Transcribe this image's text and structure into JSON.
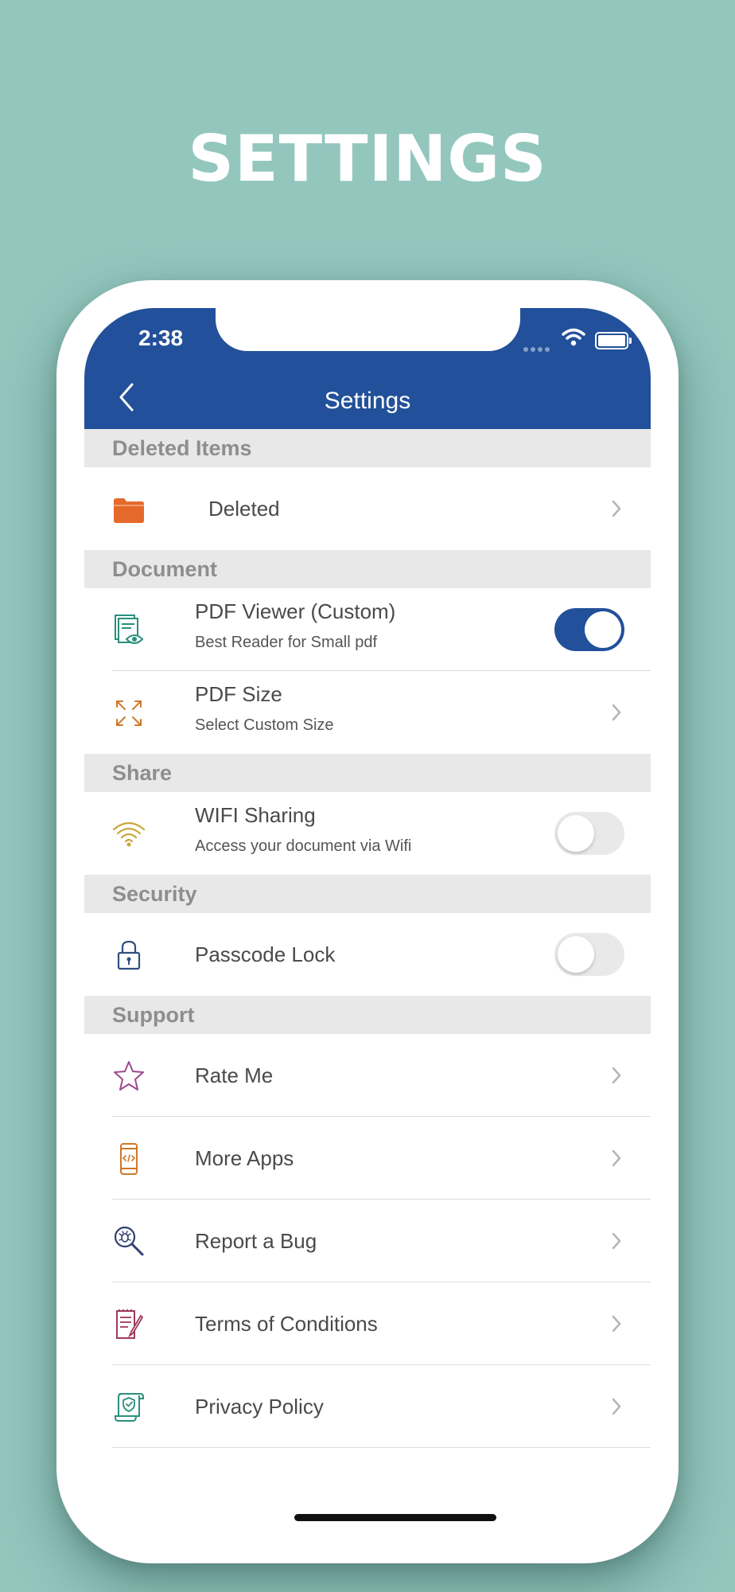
{
  "promo": {
    "title": "SETTINGS"
  },
  "status_bar": {
    "time": "2:38"
  },
  "nav": {
    "title": "Settings",
    "back_icon": "chevron-left-icon"
  },
  "colors": {
    "background": "#93c7be",
    "header": "#22509a",
    "section_header_bg": "#e8e8e8",
    "toggle_on": "#22509a"
  },
  "sections": [
    {
      "title": "Deleted Items"
    },
    {
      "title": "Document"
    },
    {
      "title": "Share"
    },
    {
      "title": "Security"
    },
    {
      "title": "Support"
    }
  ],
  "rows": {
    "deleted": {
      "label": "Deleted",
      "icon": "folder-icon",
      "accessory": "chevron"
    },
    "pdf_viewer": {
      "label": "PDF Viewer (Custom)",
      "subtitle": "Best Reader for Small pdf",
      "icon": "document-eye-icon",
      "toggle": "on"
    },
    "pdf_size": {
      "label": "PDF Size",
      "subtitle": "Select Custom Size",
      "icon": "expand-icon",
      "accessory": "chevron"
    },
    "wifi_sharing": {
      "label": "WIFI Sharing",
      "subtitle": "Access your document via Wifi",
      "icon": "wifi-icon",
      "toggle": "off"
    },
    "passcode_lock": {
      "label": "Passcode Lock",
      "icon": "lock-icon",
      "toggle": "off"
    },
    "rate_me": {
      "label": "Rate Me",
      "icon": "star-icon",
      "accessory": "chevron"
    },
    "more_apps": {
      "label": "More Apps",
      "icon": "phone-code-icon",
      "accessory": "chevron"
    },
    "report_bug": {
      "label": "Report a Bug",
      "icon": "bug-search-icon",
      "accessory": "chevron"
    },
    "terms": {
      "label": "Terms of Conditions",
      "icon": "document-pen-icon",
      "accessory": "chevron"
    },
    "privacy": {
      "label": "Privacy Policy",
      "icon": "shield-scroll-icon",
      "accessory": "chevron"
    }
  }
}
